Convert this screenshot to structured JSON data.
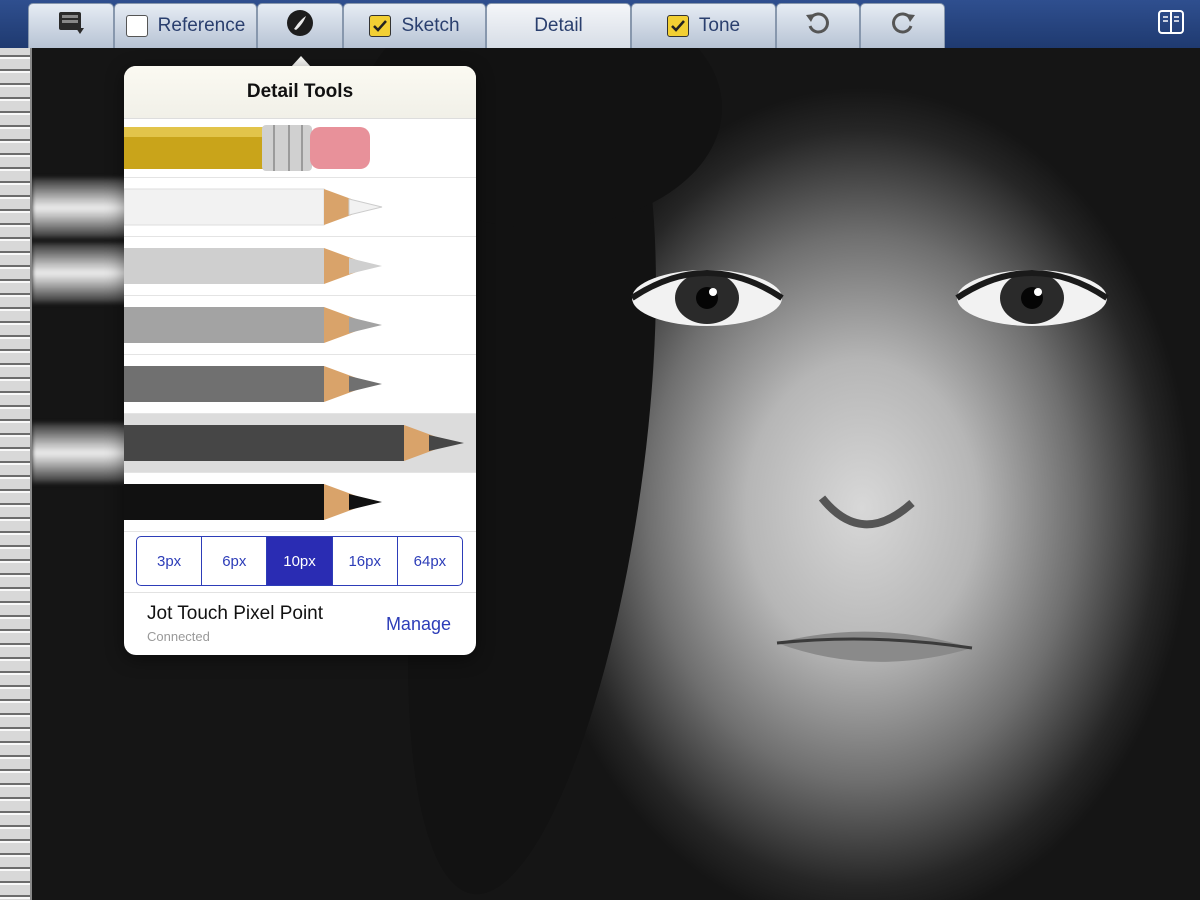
{
  "toolbar": {
    "tabs": [
      {
        "label": "",
        "icon": "notebook-icon",
        "checkbox": null
      },
      {
        "label": "Reference",
        "checkbox": false
      },
      {
        "label": "",
        "icon": "brush-icon",
        "checkbox": null
      },
      {
        "label": "Sketch",
        "checkbox": true
      },
      {
        "label": "Detail",
        "checkbox": null,
        "active": true
      },
      {
        "label": "Tone",
        "checkbox": true
      },
      {
        "label": "",
        "icon": "undo-icon"
      },
      {
        "label": "",
        "icon": "redo-icon"
      }
    ],
    "right_icon": "layers-panel-icon"
  },
  "popover": {
    "title": "Detail Tools",
    "tools": [
      {
        "name": "eraser",
        "color": "#c9a41a"
      },
      {
        "name": "pencil-white",
        "color": "#f2f2f2"
      },
      {
        "name": "pencil-light-gray",
        "color": "#cfcfcf"
      },
      {
        "name": "pencil-gray",
        "color": "#a3a3a3"
      },
      {
        "name": "pencil-dark-gray",
        "color": "#707070"
      },
      {
        "name": "pencil-charcoal",
        "color": "#464646",
        "selected": true
      },
      {
        "name": "pencil-black",
        "color": "#111111"
      }
    ],
    "sizes": [
      "3px",
      "6px",
      "10px",
      "16px",
      "64px"
    ],
    "selected_size": "10px",
    "device": {
      "name": "Jot Touch Pixel Point",
      "status": "Connected",
      "action": "Manage"
    }
  },
  "colors": {
    "toolbar": "#2f4f8f",
    "tab": "#cdd6e2",
    "accent": "#2d3db8",
    "checkbox_checked": "#f2cf33"
  }
}
